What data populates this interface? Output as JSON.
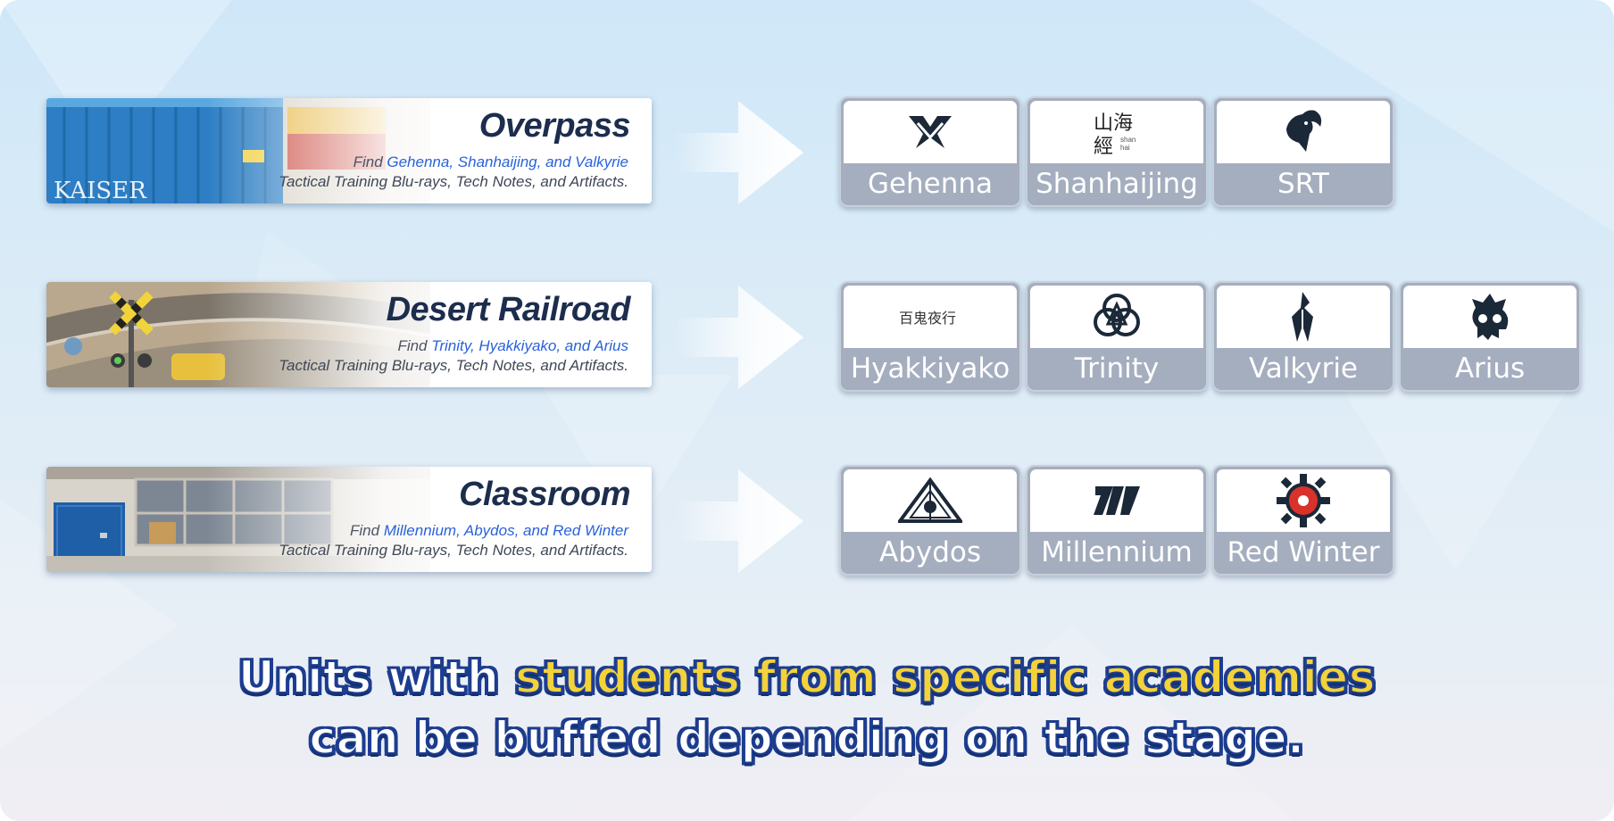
{
  "stages": [
    {
      "name": "Overpass",
      "find_prefix": "Find ",
      "find_highlight": "Gehenna, Shanhaijing, and Valkyrie",
      "description": "Tactical Training Blu-rays, Tech Notes, and Artifacts."
    },
    {
      "name": "Desert Railroad",
      "find_prefix": "Find ",
      "find_highlight": "Trinity, Hyakkiyako, and Arius",
      "description": "Tactical Training Blu-rays, Tech Notes, and Artifacts."
    },
    {
      "name": "Classroom",
      "find_prefix": "Find ",
      "find_highlight": "Millennium, Abydos, and Red Winter",
      "description": "Tactical Training Blu-rays, Tech Notes, and Artifacts."
    }
  ],
  "academies": [
    [
      {
        "label": "Gehenna",
        "icon": "gehenna-emblem-icon"
      },
      {
        "label": "Shanhaijing",
        "icon": "shanhaijing-emblem-icon"
      },
      {
        "label": "SRT",
        "icon": "srt-emblem-icon"
      }
    ],
    [
      {
        "label": "Hyakkiyako",
        "icon": "hyakkiyako-emblem-icon"
      },
      {
        "label": "Trinity",
        "icon": "trinity-emblem-icon"
      },
      {
        "label": "Valkyrie",
        "icon": "valkyrie-emblem-icon"
      },
      {
        "label": "Arius",
        "icon": "arius-emblem-icon"
      }
    ],
    [
      {
        "label": "Abydos",
        "icon": "abydos-emblem-icon"
      },
      {
        "label": "Millennium",
        "icon": "millennium-emblem-icon"
      },
      {
        "label": "Red Winter",
        "icon": "red-winter-emblem-icon"
      }
    ]
  ],
  "caption": {
    "line1_white": "Units with ",
    "line1_yellow": "students from specific academies",
    "line2": "can be buffed depending on the stage."
  },
  "colors": {
    "highlight_blue": "#2a62d8",
    "caption_yellow": "#f3d23a",
    "caption_outline": "#1d3d8f",
    "card_label_bg": "#a5aebf"
  }
}
